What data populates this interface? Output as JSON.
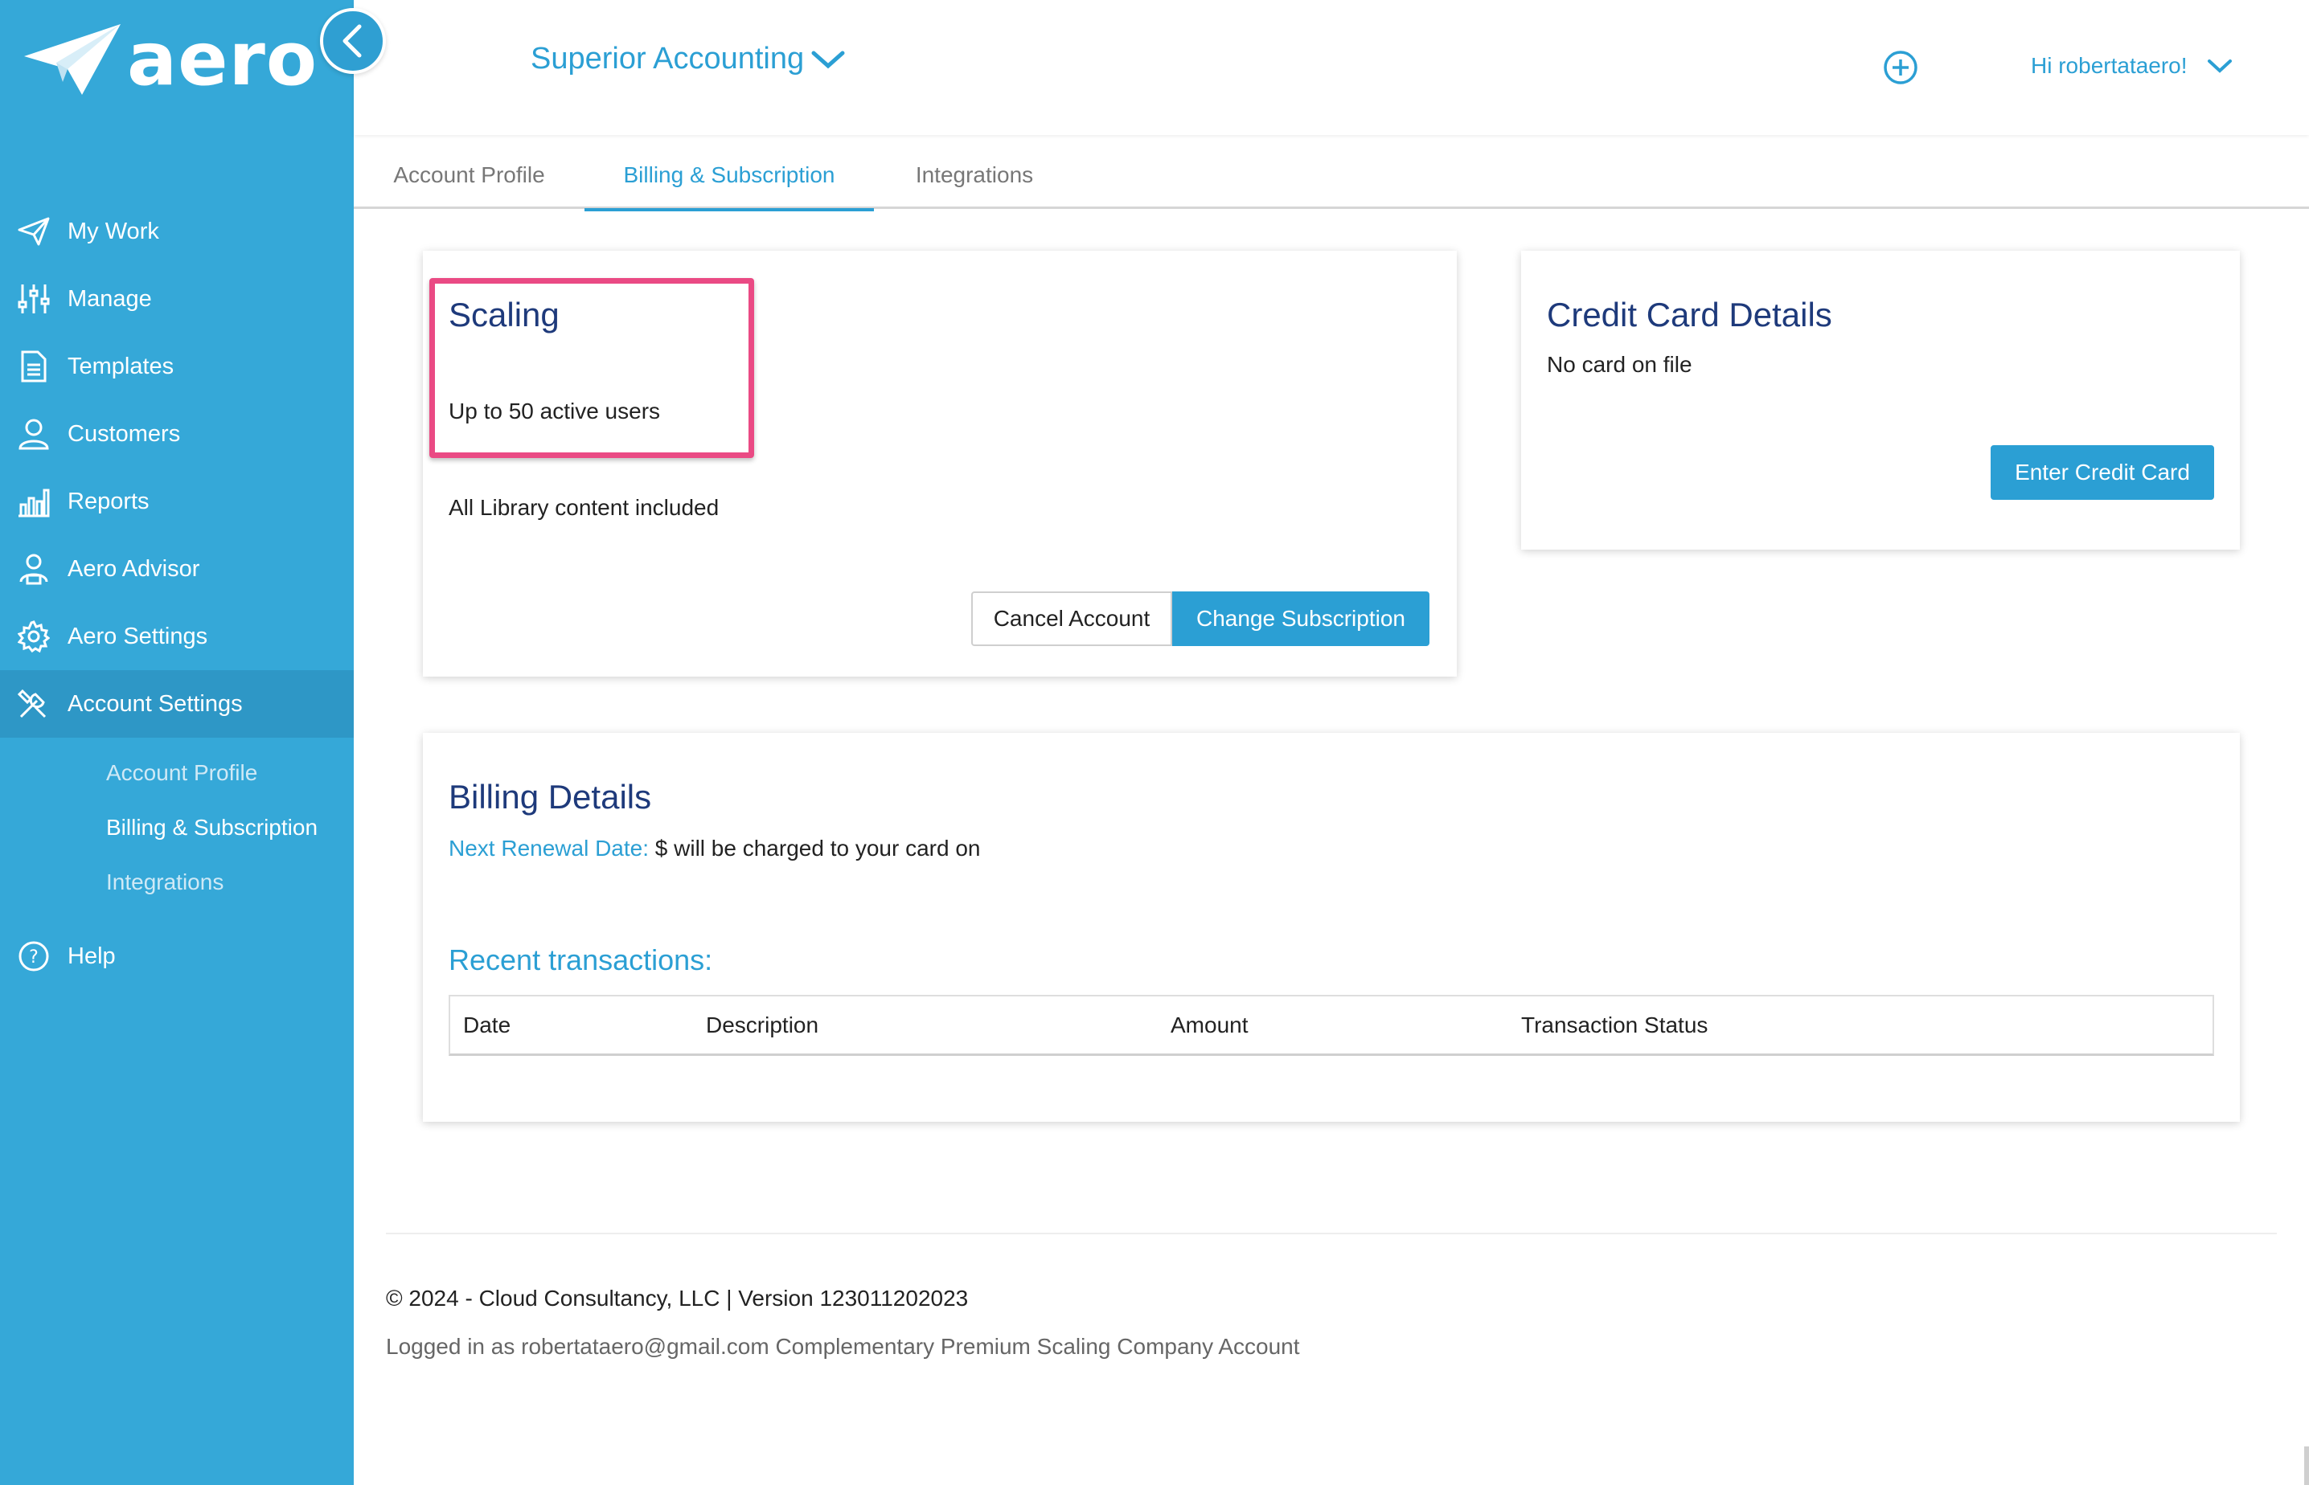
{
  "brand": {
    "name": "aero",
    "logo_icon": "paper-plane-icon"
  },
  "colors": {
    "sidebar": "#35a8d8",
    "accent": "#2b9fd4",
    "title": "#1e3a7b",
    "highlight": "#ea4a84"
  },
  "header": {
    "company": "Superior Accounting",
    "greeting": "Hi robertataero!"
  },
  "sidebar": {
    "items": [
      {
        "label": "My Work",
        "icon": "paper-plane-icon"
      },
      {
        "label": "Manage",
        "icon": "sliders-icon"
      },
      {
        "label": "Templates",
        "icon": "document-icon"
      },
      {
        "label": "Customers",
        "icon": "person-icon"
      },
      {
        "label": "Reports",
        "icon": "bar-chart-icon"
      },
      {
        "label": "Aero Advisor",
        "icon": "advisor-icon"
      },
      {
        "label": "Aero Settings",
        "icon": "gear-icon"
      },
      {
        "label": "Account Settings",
        "icon": "tools-icon"
      }
    ],
    "subitems": [
      {
        "label": "Account Profile"
      },
      {
        "label": "Billing & Subscription"
      },
      {
        "label": "Integrations"
      }
    ],
    "help": {
      "label": "Help",
      "icon": "help-icon"
    }
  },
  "tabs": [
    {
      "label": "Account Profile"
    },
    {
      "label": "Billing & Subscription"
    },
    {
      "label": "Integrations"
    }
  ],
  "subscription": {
    "plan": "Scaling",
    "users": "Up to 50 active users",
    "library": "All Library content included",
    "cancel_label": "Cancel Account",
    "change_label": "Change Subscription"
  },
  "credit_card": {
    "title": "Credit Card Details",
    "status": "No card on file",
    "button_label": "Enter Credit Card"
  },
  "billing": {
    "title": "Billing Details",
    "renewal_label": "Next Renewal Date:",
    "renewal_text": "$ will be charged to your card on",
    "recent_label": "Recent transactions:",
    "columns": [
      "Date",
      "Description",
      "Amount",
      "Transaction Status"
    ]
  },
  "footer": {
    "copyright": "© 2024 - Cloud Consultancy, LLC | Version 123011202023",
    "logged_in": "Logged in as robertataero@gmail.com Complementary Premium Scaling Company Account"
  }
}
